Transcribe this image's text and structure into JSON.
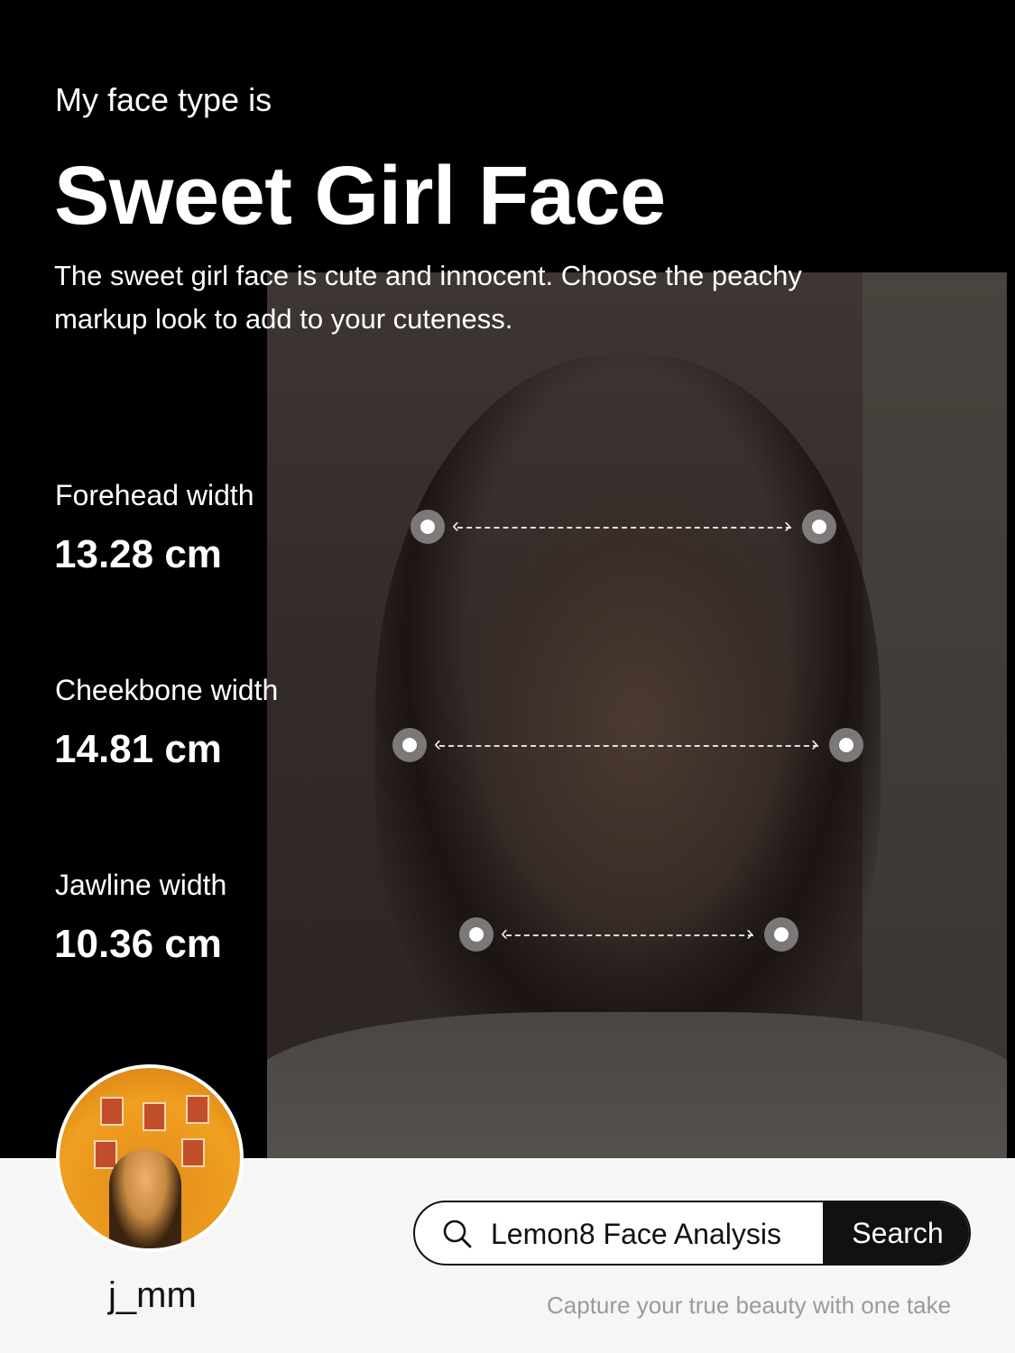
{
  "header": {
    "intro": "My face type is",
    "title": "Sweet Girl Face",
    "description": "The sweet girl face is cute and innocent. Choose the peachy markup look to add to your cuteness."
  },
  "metrics": [
    {
      "label": "Forehead width",
      "value": "13.28 cm"
    },
    {
      "label": "Cheekbone width",
      "value": "14.81 cm"
    },
    {
      "label": "Jawline width",
      "value": "10.36 cm"
    }
  ],
  "profile": {
    "username": "j_mm"
  },
  "search": {
    "query": "Lemon8 Face Analysis",
    "button_label": "Search"
  },
  "footer": {
    "tagline": "Capture your true beauty with one take"
  },
  "colors": {
    "background": "#000000",
    "panel": "#f6f6f6",
    "accent_dark": "#111111"
  }
}
